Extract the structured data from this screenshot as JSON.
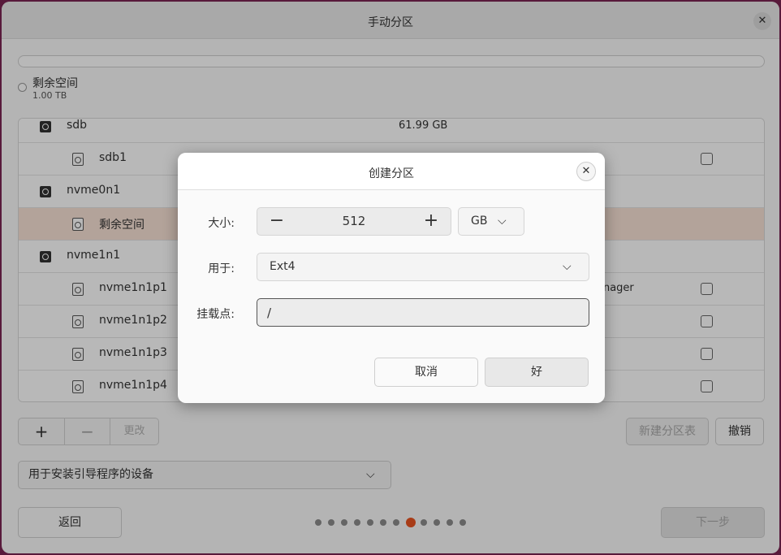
{
  "window": {
    "title": "手动分区"
  },
  "free_space": {
    "label": "剩余空间",
    "size": "1.00 TB"
  },
  "rows": [
    {
      "kind": "disk",
      "name": "sdb",
      "size": "61.99 GB",
      "extra": "",
      "checkbox": false,
      "selected": false
    },
    {
      "kind": "part",
      "name": "sdb1",
      "size": "",
      "extra": "",
      "checkbox": true,
      "selected": false
    },
    {
      "kind": "disk",
      "name": "nvme0n1",
      "size": "",
      "extra": "",
      "checkbox": false,
      "selected": false
    },
    {
      "kind": "part",
      "name": "剩余空间",
      "size": "",
      "extra": "",
      "checkbox": false,
      "selected": true
    },
    {
      "kind": "disk",
      "name": "nvme1n1",
      "size": "",
      "extra": "",
      "checkbox": false,
      "selected": false
    },
    {
      "kind": "part",
      "name": "nvme1n1p1",
      "size": "",
      "extra": "anager",
      "checkbox": true,
      "selected": false
    },
    {
      "kind": "part",
      "name": "nvme1n1p2",
      "size": "",
      "extra": "",
      "checkbox": true,
      "selected": false
    },
    {
      "kind": "part",
      "name": "nvme1n1p3",
      "size": "",
      "extra": "",
      "checkbox": true,
      "selected": false
    },
    {
      "kind": "part",
      "name": "nvme1n1p4",
      "size": "",
      "extra": "",
      "checkbox": true,
      "selected": false
    }
  ],
  "toolbar": {
    "add": "+",
    "remove": "−",
    "change": "更改",
    "new_table": "新建分区表",
    "revert": "撤销"
  },
  "boot_device": {
    "label": "用于安装引导程序的设备"
  },
  "nav": {
    "back": "返回",
    "next": "下一步",
    "pages": 12,
    "current_page": 8
  },
  "dialog": {
    "title": "创建分区",
    "size_label": "大小:",
    "size_value": "512",
    "decrement": "−",
    "increment": "+",
    "unit": "GB",
    "use_label": "用于:",
    "use_value": "Ext4",
    "mount_label": "挂载点:",
    "mount_value": "/",
    "cancel": "取消",
    "ok": "好"
  }
}
